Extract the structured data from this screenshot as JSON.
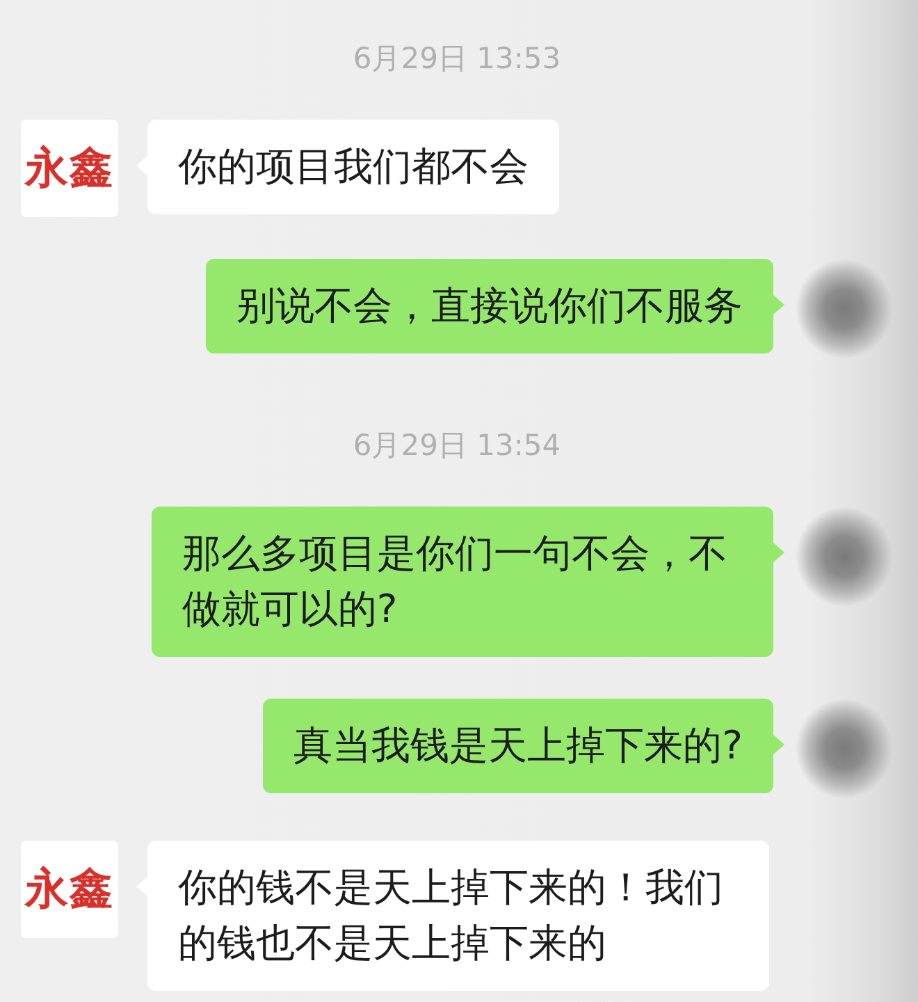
{
  "chat": {
    "items": [
      {
        "kind": "timestamp",
        "text": "6月29日 13:53"
      },
      {
        "kind": "received",
        "avatar": "永鑫",
        "text": "你的项目我们都不会"
      },
      {
        "kind": "sent",
        "text": "别说不会，直接说你们不服务"
      },
      {
        "kind": "timestamp",
        "text": "6月29日 13:54"
      },
      {
        "kind": "sent",
        "text": "那么多项目是你们一句不会，不做就可以的?"
      },
      {
        "kind": "sent",
        "text": "真当我钱是天上掉下来的?"
      },
      {
        "kind": "received",
        "avatar": "永鑫",
        "text": "你的钱不是天上掉下来的！我们的钱也不是天上掉下来的"
      }
    ]
  }
}
